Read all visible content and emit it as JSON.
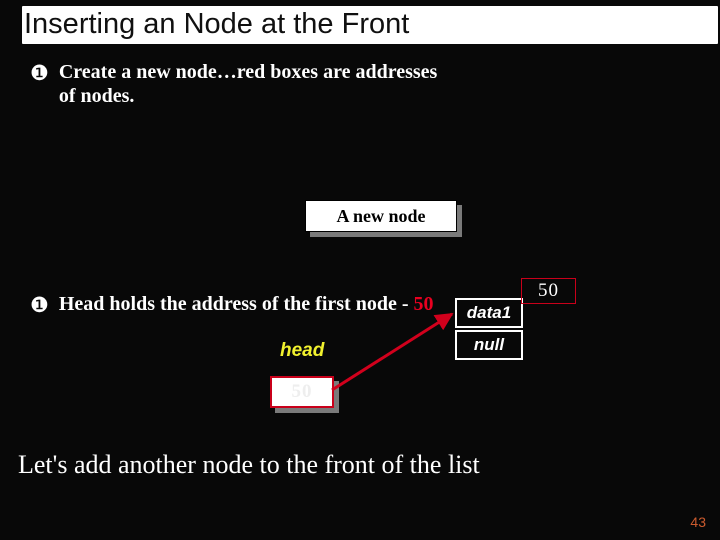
{
  "title": "Inserting an Node at the Front",
  "bullet_icons": {
    "b1": "❶",
    "b2": "❶"
  },
  "bullet1": "Create a new node…red boxes are addresses of nodes.",
  "newnode_label": "A new node",
  "bullet2_pre": "Head holds the address of the first node  - ",
  "bullet2_val": "50",
  "head_label": "head",
  "head_value": "50",
  "node1": {
    "addr": "50",
    "data_label": "data1",
    "next_label": "null"
  },
  "footer": "Let's add another node to the front of the list",
  "page": "43"
}
